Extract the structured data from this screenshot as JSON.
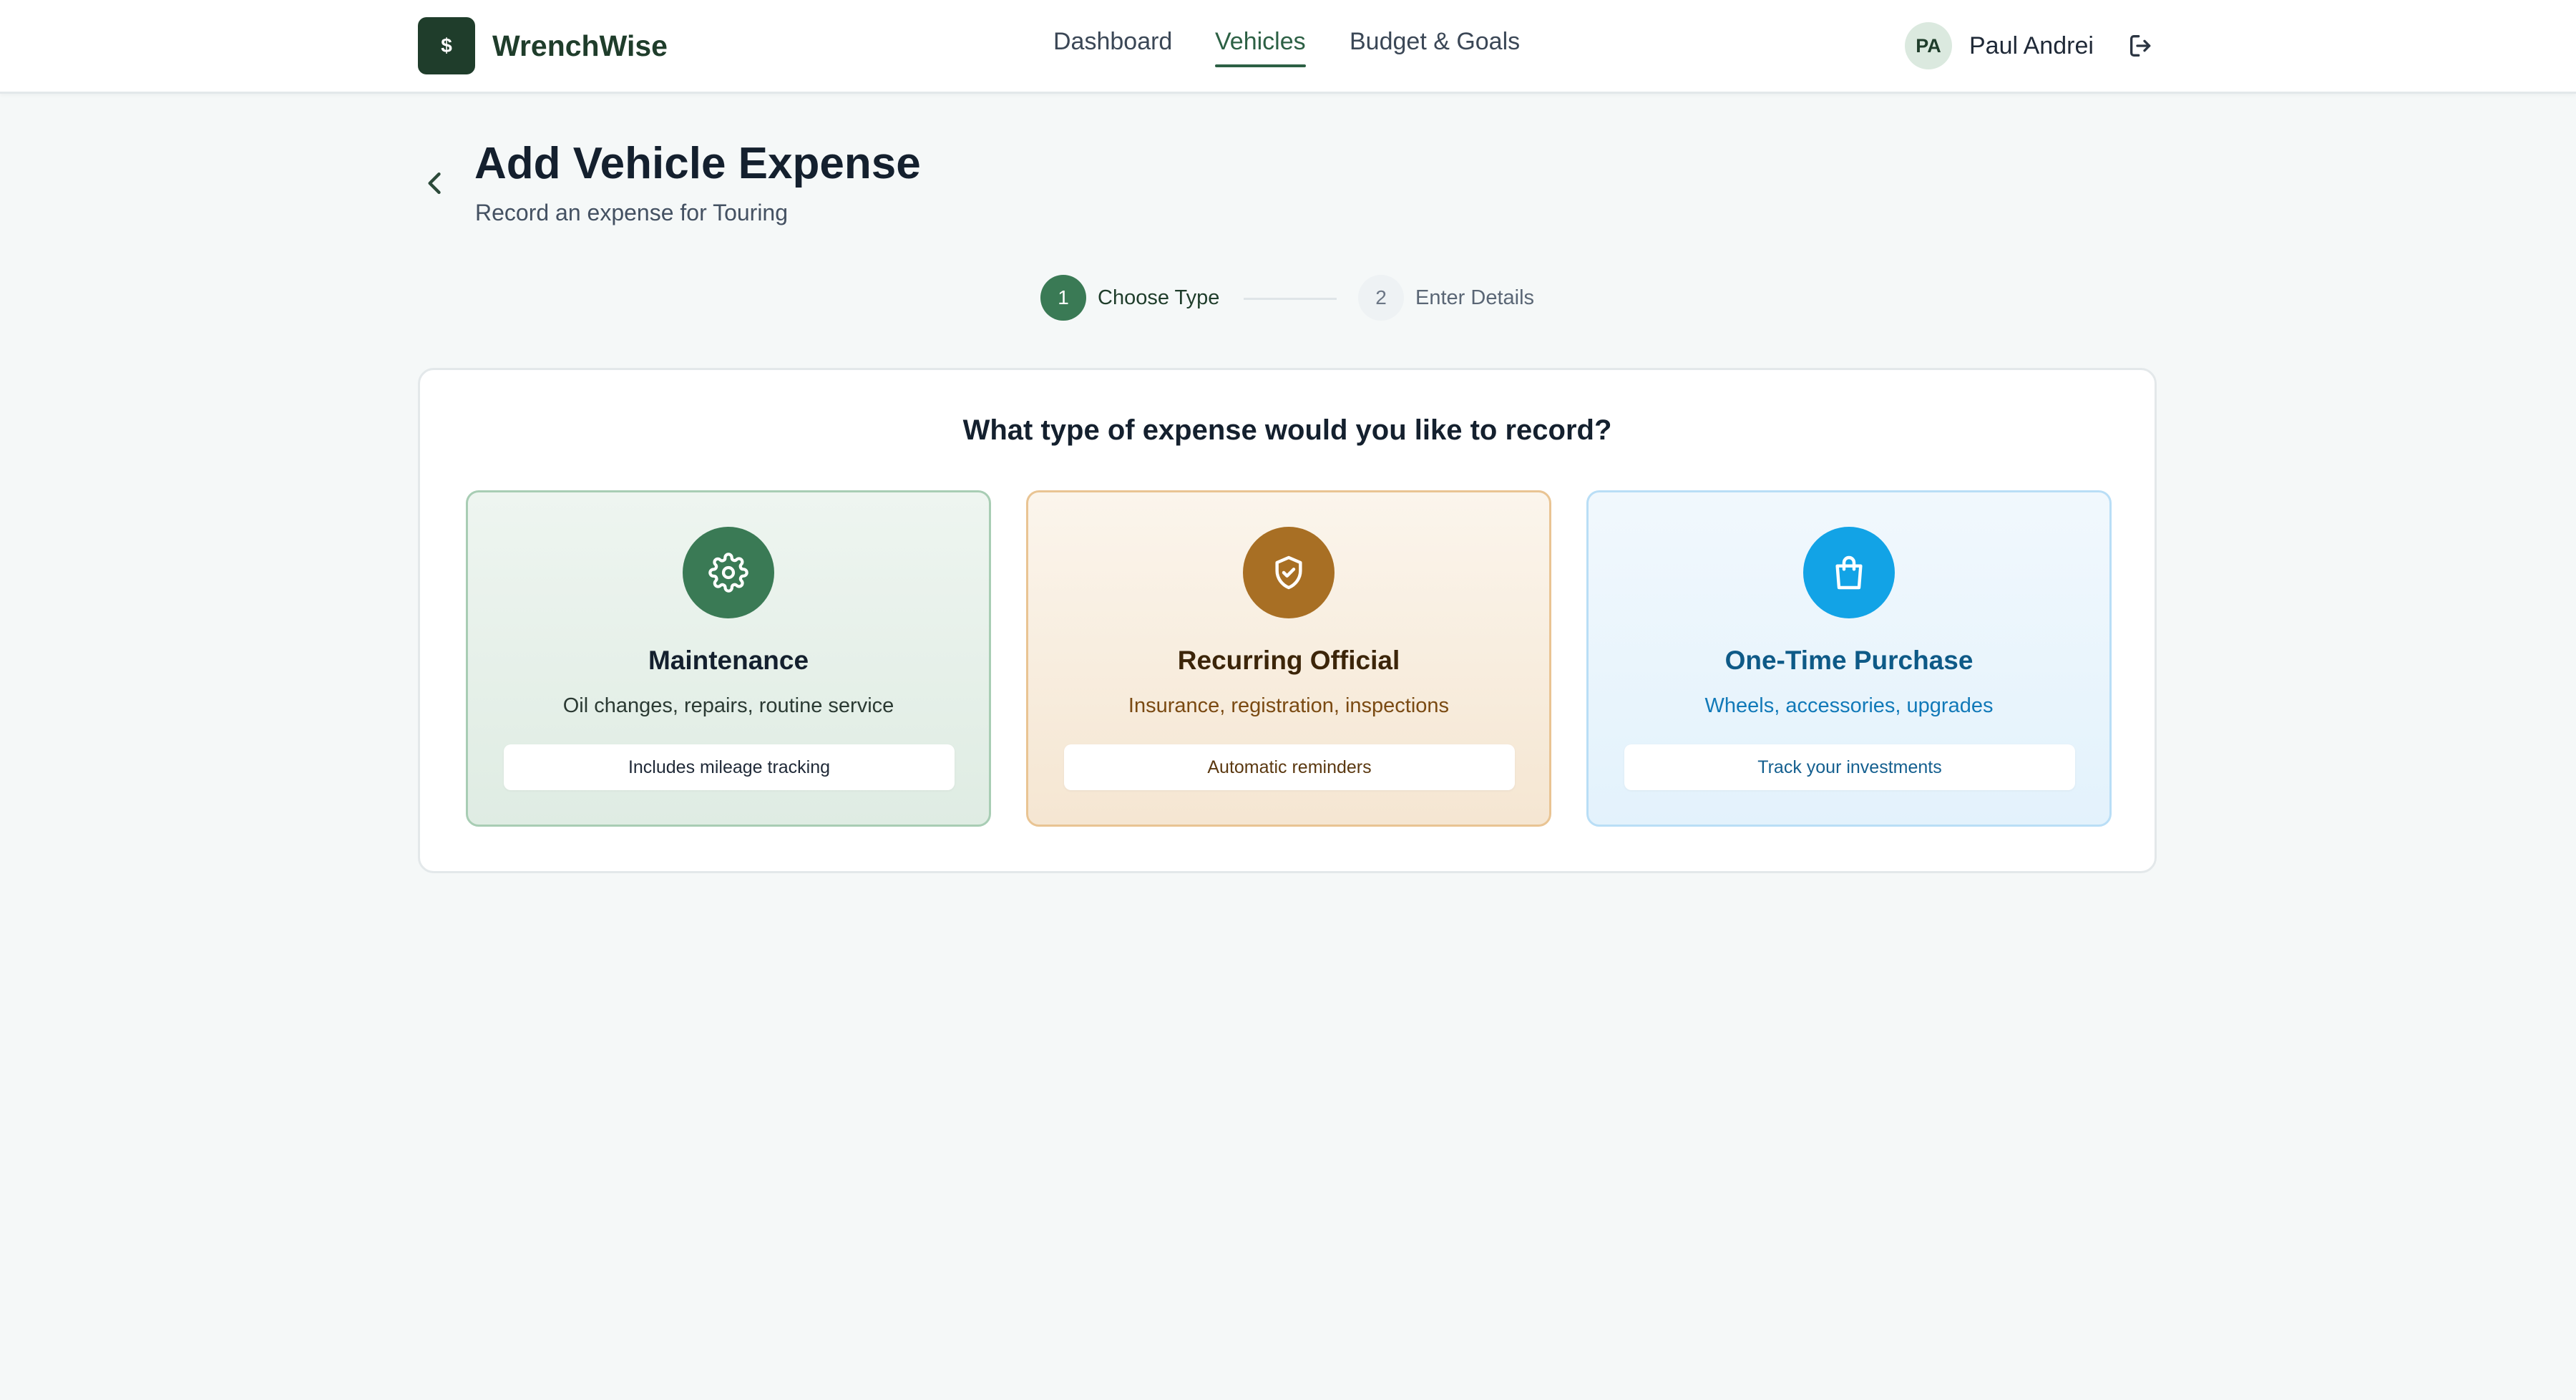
{
  "app": {
    "logo_symbol": "$",
    "name": "WrenchWise"
  },
  "nav": {
    "items": [
      {
        "label": "Dashboard",
        "active": false
      },
      {
        "label": "Vehicles",
        "active": true
      },
      {
        "label": "Budget & Goals",
        "active": false
      }
    ]
  },
  "user": {
    "initials": "PA",
    "name": "Paul Andrei",
    "logout_icon": "logout-icon"
  },
  "page": {
    "back_icon": "chevron-left-icon",
    "title": "Add Vehicle Expense",
    "subtitle": "Record an expense for Touring"
  },
  "stepper": {
    "steps": [
      {
        "number": "1",
        "label": "Choose Type",
        "state": "current"
      },
      {
        "number": "2",
        "label": "Enter Details",
        "state": "upcoming"
      }
    ]
  },
  "expense_types": {
    "question": "What type of expense would you like to record?",
    "cards": [
      {
        "icon": "gear-icon",
        "title": "Maintenance",
        "description": "Oil changes, repairs, routine service",
        "badge": "Includes mileage tracking",
        "accent": "#3a7a55"
      },
      {
        "icon": "shield-check-icon",
        "title": "Recurring Official",
        "description": "Insurance, registration, inspections",
        "badge": "Automatic reminders",
        "accent": "#a86f24"
      },
      {
        "icon": "shopping-bag-icon",
        "title": "One-Time Purchase",
        "description": "Wheels, accessories, upgrades",
        "badge": "Track your investments",
        "accent": "#12a3e6"
      }
    ]
  },
  "colors": {
    "brand": "#1f3d2b",
    "primary": "#2c6044",
    "background": "#f5f8f8"
  }
}
